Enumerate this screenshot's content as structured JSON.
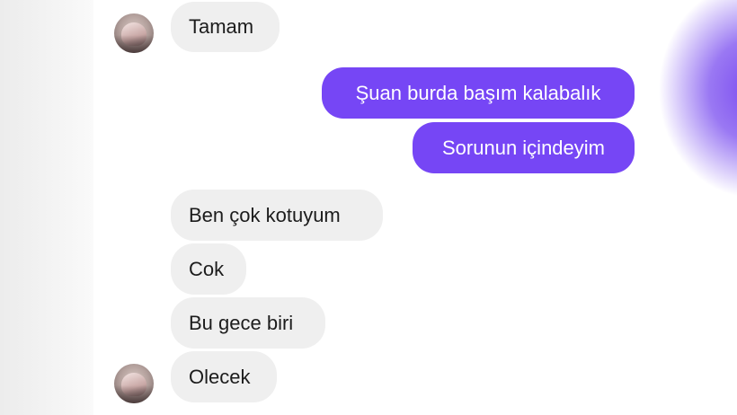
{
  "colors": {
    "outgoing_bubble": "#7646f5",
    "incoming_bubble": "#efefef",
    "incoming_text": "#1c1c1c",
    "outgoing_text": "#ffffff"
  },
  "messages": [
    {
      "side": "incoming",
      "text": "Tamam",
      "avatar": true
    },
    {
      "side": "outgoing",
      "text": "Şuan burda başım kalabalık"
    },
    {
      "side": "outgoing",
      "text": "Sorunun içindeyim"
    },
    {
      "side": "incoming",
      "text": "Ben çok kotuyum"
    },
    {
      "side": "incoming",
      "text": "Cok"
    },
    {
      "side": "incoming",
      "text": "Bu gece biri"
    },
    {
      "side": "incoming",
      "text": "Olecek",
      "avatar": true
    }
  ]
}
